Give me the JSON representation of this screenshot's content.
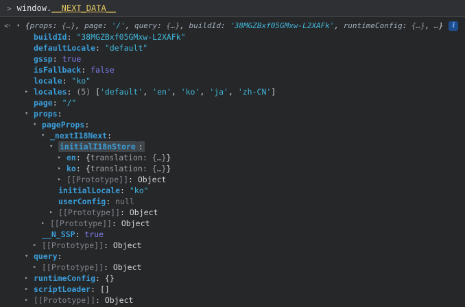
{
  "colors": {
    "background": "#262729",
    "input_background": "#2e3034",
    "divider": "#47484b",
    "key_blue": "#3b9eda",
    "string_cyan": "#42b7da",
    "boolean_purple": "#817ef2",
    "null_gray": "#81858d",
    "muted_gray": "#9aa0a6",
    "prototype_gray": "#82868e",
    "plain_text": "#d5d7db",
    "preview_key": "#a4b1bf",
    "command_gold": "#e2c55e",
    "highlight_bg": "#40454a",
    "info_icon_bg": "#1d4e8f",
    "info_icon_fg": "#7ab3f5"
  },
  "icons": {
    "prompt": ">",
    "result_marker": "<·",
    "expanded": "▾",
    "collapsed": "▸",
    "info": "i"
  },
  "console": {
    "input_tokens": [
      {
        "t": "plain",
        "x": "window."
      },
      {
        "t": "highlight",
        "x": "__NEXT_DATA__"
      }
    ],
    "result_preview": {
      "segments": [
        {
          "t": "p",
          "x": "{"
        },
        {
          "t": "pk",
          "x": "props"
        },
        {
          "t": "p",
          "x": ": "
        },
        {
          "t": "m",
          "x": "{…}"
        },
        {
          "t": "p",
          "x": ", "
        },
        {
          "t": "pk",
          "x": "page"
        },
        {
          "t": "p",
          "x": ": "
        },
        {
          "t": "s",
          "x": "'/'"
        },
        {
          "t": "p",
          "x": ", "
        },
        {
          "t": "pk",
          "x": "query"
        },
        {
          "t": "p",
          "x": ": "
        },
        {
          "t": "m",
          "x": "{…}"
        },
        {
          "t": "p",
          "x": ", "
        },
        {
          "t": "pk",
          "x": "buildId"
        },
        {
          "t": "p",
          "x": ": "
        },
        {
          "t": "s",
          "x": "'38MGZBxf05GMxw-L2XAFk'"
        },
        {
          "t": "p",
          "x": ", "
        },
        {
          "t": "pk",
          "x": "runtimeConfig"
        },
        {
          "t": "p",
          "x": ": "
        },
        {
          "t": "m",
          "x": "{…}"
        },
        {
          "t": "p",
          "x": ", "
        },
        {
          "t": "m",
          "x": "…"
        },
        {
          "t": "p",
          "x": "}"
        }
      ]
    },
    "tree_rows": [
      {
        "level": 1,
        "arrow": null,
        "segs": [
          {
            "t": "k",
            "x": "buildId"
          },
          {
            "t": "p",
            "x": ": "
          },
          {
            "t": "s",
            "x": "\"38MGZBxf05GMxw-L2XAFk\""
          }
        ]
      },
      {
        "level": 1,
        "arrow": null,
        "segs": [
          {
            "t": "k",
            "x": "defaultLocale"
          },
          {
            "t": "p",
            "x": ": "
          },
          {
            "t": "s",
            "x": "\"default\""
          }
        ]
      },
      {
        "level": 1,
        "arrow": null,
        "segs": [
          {
            "t": "k",
            "x": "gssp"
          },
          {
            "t": "p",
            "x": ": "
          },
          {
            "t": "b",
            "x": "true"
          }
        ]
      },
      {
        "level": 1,
        "arrow": null,
        "segs": [
          {
            "t": "k",
            "x": "isFallback"
          },
          {
            "t": "p",
            "x": ": "
          },
          {
            "t": "b",
            "x": "false"
          }
        ]
      },
      {
        "level": 1,
        "arrow": null,
        "segs": [
          {
            "t": "k",
            "x": "locale"
          },
          {
            "t": "p",
            "x": ": "
          },
          {
            "t": "s",
            "x": "\"ko\""
          }
        ]
      },
      {
        "level": 1,
        "arrow": "collapsed",
        "segs": [
          {
            "t": "k",
            "x": "locales"
          },
          {
            "t": "p",
            "x": ": "
          },
          {
            "t": "m",
            "x": "(5) "
          },
          {
            "t": "p",
            "x": "["
          },
          {
            "t": "s",
            "x": "'default'"
          },
          {
            "t": "p",
            "x": ", "
          },
          {
            "t": "s",
            "x": "'en'"
          },
          {
            "t": "p",
            "x": ", "
          },
          {
            "t": "s",
            "x": "'ko'"
          },
          {
            "t": "p",
            "x": ", "
          },
          {
            "t": "s",
            "x": "'ja'"
          },
          {
            "t": "p",
            "x": ", "
          },
          {
            "t": "s",
            "x": "'zh-CN'"
          },
          {
            "t": "p",
            "x": "]"
          }
        ]
      },
      {
        "level": 1,
        "arrow": null,
        "segs": [
          {
            "t": "k",
            "x": "page"
          },
          {
            "t": "p",
            "x": ": "
          },
          {
            "t": "s",
            "x": "\"/\""
          }
        ]
      },
      {
        "level": 1,
        "arrow": "expanded",
        "segs": [
          {
            "t": "k",
            "x": "props"
          },
          {
            "t": "p",
            "x": ":"
          }
        ]
      },
      {
        "level": 2,
        "arrow": "expanded",
        "segs": [
          {
            "t": "k",
            "x": "pageProps"
          },
          {
            "t": "p",
            "x": ":"
          }
        ]
      },
      {
        "level": 3,
        "arrow": "expanded",
        "segs": [
          {
            "t": "k",
            "x": "_nextI18Next"
          },
          {
            "t": "p",
            "x": ":"
          }
        ]
      },
      {
        "level": 4,
        "arrow": "expanded",
        "segs": [
          {
            "t": "k",
            "x": "initialI18nStore",
            "hl": true
          },
          {
            "t": "p",
            "x": ":",
            "hl": true
          }
        ]
      },
      {
        "level": 5,
        "arrow": "collapsed",
        "segs": [
          {
            "t": "k",
            "x": "en"
          },
          {
            "t": "p",
            "x": ": "
          },
          {
            "t": "p",
            "x": "{"
          },
          {
            "t": "m",
            "x": "translation: {…}"
          },
          {
            "t": "p",
            "x": "}"
          }
        ]
      },
      {
        "level": 5,
        "arrow": "collapsed",
        "segs": [
          {
            "t": "k",
            "x": "ko"
          },
          {
            "t": "p",
            "x": ": "
          },
          {
            "t": "p",
            "x": "{"
          },
          {
            "t": "m",
            "x": "translation: {…}"
          },
          {
            "t": "p",
            "x": "}"
          }
        ]
      },
      {
        "level": 5,
        "arrow": "collapsed",
        "segs": [
          {
            "t": "d",
            "x": "[[Prototype]]"
          },
          {
            "t": "p",
            "x": ": "
          },
          {
            "t": "p",
            "x": "Object"
          }
        ]
      },
      {
        "level": 4,
        "arrow": null,
        "segs": [
          {
            "t": "k",
            "x": "initialLocale"
          },
          {
            "t": "p",
            "x": ": "
          },
          {
            "t": "s",
            "x": "\"ko\""
          }
        ]
      },
      {
        "level": 4,
        "arrow": null,
        "segs": [
          {
            "t": "k",
            "x": "userConfig"
          },
          {
            "t": "p",
            "x": ": "
          },
          {
            "t": "n",
            "x": "null"
          }
        ]
      },
      {
        "level": 4,
        "arrow": "collapsed",
        "segs": [
          {
            "t": "d",
            "x": "[[Prototype]]"
          },
          {
            "t": "p",
            "x": ": "
          },
          {
            "t": "p",
            "x": "Object"
          }
        ]
      },
      {
        "level": 3,
        "arrow": "collapsed",
        "segs": [
          {
            "t": "d",
            "x": "[[Prototype]]"
          },
          {
            "t": "p",
            "x": ": "
          },
          {
            "t": "p",
            "x": "Object"
          }
        ]
      },
      {
        "level": 2,
        "arrow": null,
        "segs": [
          {
            "t": "k",
            "x": "__N_SSP"
          },
          {
            "t": "p",
            "x": ": "
          },
          {
            "t": "b",
            "x": "true"
          }
        ]
      },
      {
        "level": 2,
        "arrow": "collapsed",
        "segs": [
          {
            "t": "d",
            "x": "[[Prototype]]"
          },
          {
            "t": "p",
            "x": ": "
          },
          {
            "t": "p",
            "x": "Object"
          }
        ]
      },
      {
        "level": 1,
        "arrow": "expanded",
        "segs": [
          {
            "t": "k",
            "x": "query"
          },
          {
            "t": "p",
            "x": ":"
          }
        ]
      },
      {
        "level": 2,
        "arrow": "collapsed",
        "segs": [
          {
            "t": "d",
            "x": "[[Prototype]]"
          },
          {
            "t": "p",
            "x": ": "
          },
          {
            "t": "p",
            "x": "Object"
          }
        ]
      },
      {
        "level": 1,
        "arrow": "collapsed",
        "segs": [
          {
            "t": "k",
            "x": "runtimeConfig"
          },
          {
            "t": "p",
            "x": ": "
          },
          {
            "t": "p",
            "x": "{}"
          }
        ]
      },
      {
        "level": 1,
        "arrow": "collapsed",
        "segs": [
          {
            "t": "k",
            "x": "scriptLoader"
          },
          {
            "t": "p",
            "x": ": "
          },
          {
            "t": "p",
            "x": "[]"
          }
        ]
      },
      {
        "level": 1,
        "arrow": "collapsed",
        "segs": [
          {
            "t": "d",
            "x": "[[Prototype]]"
          },
          {
            "t": "p",
            "x": ": "
          },
          {
            "t": "p",
            "x": "Object"
          }
        ]
      }
    ]
  }
}
